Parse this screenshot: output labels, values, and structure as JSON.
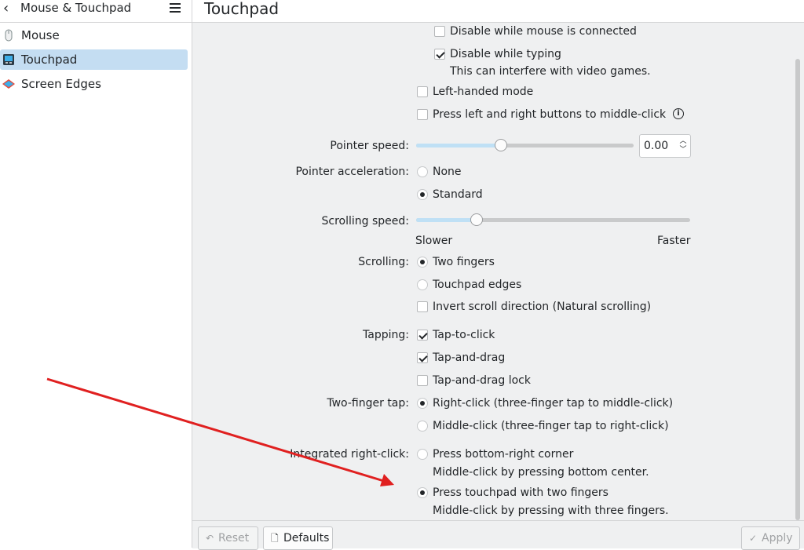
{
  "sidebar": {
    "title": "Mouse & Touchpad",
    "items": [
      {
        "label": "Mouse",
        "icon": "mouse-icon"
      },
      {
        "label": "Touchpad",
        "icon": "touchpad-icon",
        "active": true
      },
      {
        "label": "Screen Edges",
        "icon": "screen-edges-icon"
      }
    ]
  },
  "page": {
    "title": "Touchpad"
  },
  "settings": {
    "disable_while_mouse": {
      "label": "Disable while mouse is connected",
      "checked": false
    },
    "disable_while_typing": {
      "label": "Disable while typing",
      "checked": true,
      "note": "This can interfere with video games."
    },
    "left_handed": {
      "label": "Left-handed mode",
      "checked": false
    },
    "middle_click_emulation": {
      "label": "Press left and right buttons to middle-click",
      "checked": false
    },
    "pointer_speed": {
      "label": "Pointer speed:",
      "value": "0.00",
      "fraction": 0.39
    },
    "pointer_acceleration": {
      "label": "Pointer acceleration:",
      "options": [
        "None",
        "Standard"
      ],
      "selected": "Standard"
    },
    "scrolling_speed": {
      "label": "Scrolling speed:",
      "min_label": "Slower",
      "max_label": "Faster",
      "fraction": 0.22
    },
    "scrolling": {
      "label": "Scrolling:",
      "options": [
        "Two fingers",
        "Touchpad edges"
      ],
      "selected": "Two fingers",
      "invert_label": "Invert scroll direction (Natural scrolling)",
      "invert_checked": false
    },
    "tapping": {
      "label": "Tapping:",
      "tap_to_click": "Tap-to-click",
      "tap_and_drag": "Tap-and-drag",
      "tap_and_drag_lock": "Tap-and-drag lock"
    },
    "two_finger_tap": {
      "label": "Two-finger tap:",
      "options": [
        "Right-click (three-finger tap to middle-click)",
        "Middle-click (three-finger tap to right-click)"
      ],
      "selected": 0
    },
    "integrated_right_click": {
      "label": "Integrated right-click:",
      "option1": "Press bottom-right corner",
      "option1_note": "Middle-click by pressing bottom center.",
      "option2": "Press touchpad with two fingers",
      "option2_note": "Middle-click by pressing with three fingers.",
      "selected": 1
    }
  },
  "footer": {
    "reset": "Reset",
    "defaults": "Defaults",
    "apply": "Apply"
  },
  "colors": {
    "accent": "#c4ddf2",
    "annotation_arrow": "#e02020"
  }
}
